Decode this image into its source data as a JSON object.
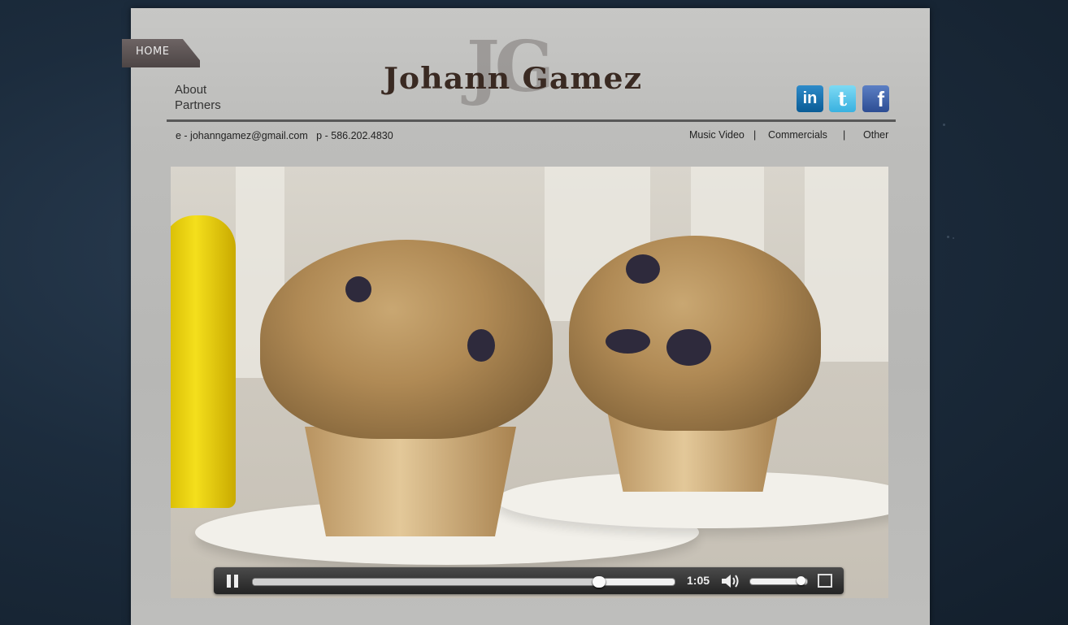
{
  "nav": {
    "home_label": "HOME",
    "side_links": [
      "About",
      "Partners"
    ],
    "categories": [
      "Music Video",
      "Commercials",
      "Other"
    ],
    "separator": "|"
  },
  "logo": {
    "monogram": "JG",
    "name": "Johann Gamez"
  },
  "social": {
    "linkedin_label": "in",
    "twitter_label": "t",
    "facebook_label": "f"
  },
  "contact": {
    "text": "e - johanngamez@gmail.com   p - 586.202.4830"
  },
  "video": {
    "current_time": "1:05",
    "progress_fraction": 0.82,
    "volume_fraction": 0.9
  }
}
